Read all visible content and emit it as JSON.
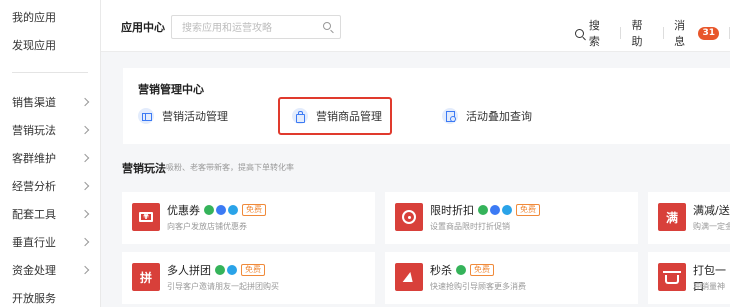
{
  "sidebar": {
    "top_items": [
      {
        "label": "我的应用"
      },
      {
        "label": "发现应用"
      }
    ],
    "items": [
      {
        "label": "销售渠道"
      },
      {
        "label": "营销玩法"
      },
      {
        "label": "客群维护"
      },
      {
        "label": "经营分析"
      },
      {
        "label": "配套工具"
      },
      {
        "label": "垂直行业"
      },
      {
        "label": "资金处理"
      },
      {
        "label": "开放服务"
      }
    ]
  },
  "header": {
    "title": "应用中心",
    "search_placeholder": "搜索应用和运营攻略",
    "search_label": "搜索",
    "help_label": "帮助",
    "messages_label": "消息",
    "messages_count": "31"
  },
  "marketing_center": {
    "title": "营销管理中心",
    "items": [
      {
        "label": "营销活动管理",
        "icon": "gift-icon"
      },
      {
        "label": "营销商品管理",
        "icon": "shopping-bag-icon"
      },
      {
        "label": "活动叠加查询",
        "icon": "document-search-icon"
      }
    ],
    "highlight_color": "#e03a2d"
  },
  "play_section": {
    "title": "营销玩法",
    "desc": "吸粉、老客带新客，提高下单转化率",
    "free_badge": "免费",
    "cards": [
      {
        "name": "优惠券",
        "desc": "向客户发放店铺优惠券",
        "icon": "coupon-icon",
        "glyph": "¥"
      },
      {
        "name": "限时折扣",
        "desc": "设置商品限时打折促销",
        "icon": "clock-icon"
      },
      {
        "name": "满减/送",
        "desc": "购满一定金",
        "icon": "full-reduction-icon",
        "glyph": "满"
      },
      {
        "name": "多人拼团",
        "desc": "引导客户邀请朋友一起拼团购买",
        "icon": "group-buy-icon",
        "glyph": "拼"
      },
      {
        "name": "秒杀",
        "desc": "快速抢购引导顾客更多消费",
        "icon": "flash-sale-icon"
      },
      {
        "name": "打包一口",
        "desc": "冲销量神",
        "icon": "basket-icon"
      }
    ]
  },
  "colors": {
    "card_icon_bg": "#d8403a",
    "badge_bg": "#e8562a",
    "free_badge": "#f08a3a",
    "icon_blue": "#3c7af4"
  }
}
